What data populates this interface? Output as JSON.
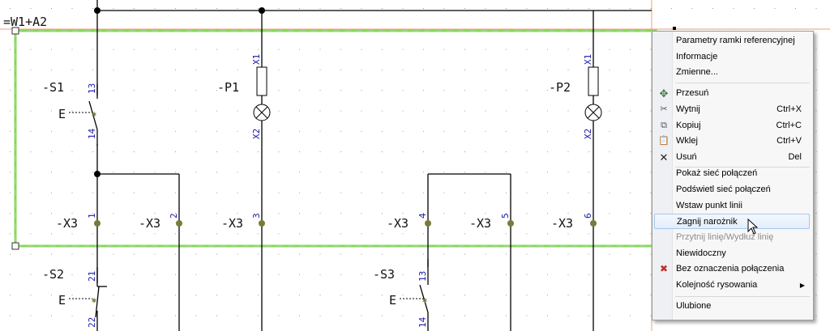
{
  "schematic": {
    "title": "=W1+A2",
    "devices": {
      "s1": "-S1",
      "s2": "-S2",
      "s3": "-S3",
      "p1": "-P1",
      "p2": "-P2",
      "x3": "-X3"
    },
    "pins": {
      "s1_top": "13",
      "s1_bot": "14",
      "s2_top": "21",
      "s2_bot": "22",
      "s3_top": "13",
      "s3_bot": "14",
      "p1_top": "X1",
      "p1_bot": "X2",
      "p2_top": "X1",
      "p2_bot": "X2",
      "x3_1": "1",
      "x3_2": "2",
      "x3_3": "3",
      "x3_4": "4",
      "x3_5": "5",
      "x3_6": "6"
    },
    "actuator_symbol": "E",
    "colors": {
      "highlight_line": "#7fdc4f",
      "pin_text": "#1a1aa6",
      "terminal": "#7a7a3a",
      "page_border": "#f0a070"
    }
  },
  "context_menu": {
    "items": [
      {
        "label": "Parametry ramki referencyjnej",
        "shortcut": "",
        "icon": ""
      },
      {
        "label": "Informacje",
        "shortcut": "",
        "icon": ""
      },
      {
        "label": "Zmienne...",
        "shortcut": "",
        "icon": ""
      },
      {
        "label": "Przesuń",
        "shortcut": "",
        "icon": "move-icon"
      },
      {
        "label": "Wytnij",
        "shortcut": "Ctrl+X",
        "icon": "scissors-icon"
      },
      {
        "label": "Kopiuj",
        "shortcut": "Ctrl+C",
        "icon": "copy-icon"
      },
      {
        "label": "Wklej",
        "shortcut": "Ctrl+V",
        "icon": "paste-icon"
      },
      {
        "label": "Usuń",
        "shortcut": "Del",
        "icon": "delete-icon"
      },
      {
        "label": "Pokaż sieć połączeń",
        "shortcut": "",
        "icon": ""
      },
      {
        "label": "Podświetl sieć połączeń",
        "shortcut": "",
        "icon": ""
      },
      {
        "label": "Wstaw punkt linii",
        "shortcut": "",
        "icon": ""
      },
      {
        "label": "Zagnij narożnik",
        "shortcut": "",
        "icon": "",
        "state": "hover"
      },
      {
        "label": "Przytnij linię/Wydłuż linię",
        "shortcut": "",
        "icon": "",
        "state": "disabled"
      },
      {
        "label": "Niewidoczny",
        "shortcut": "",
        "icon": ""
      },
      {
        "label": "Bez oznaczenia połączenia",
        "shortcut": "",
        "icon": "no-connection-mark-icon"
      },
      {
        "label": "Kolejność rysowania",
        "shortcut": "",
        "icon": "",
        "submenu": true
      },
      {
        "label": "Ulubione",
        "shortcut": "",
        "icon": ""
      }
    ]
  }
}
